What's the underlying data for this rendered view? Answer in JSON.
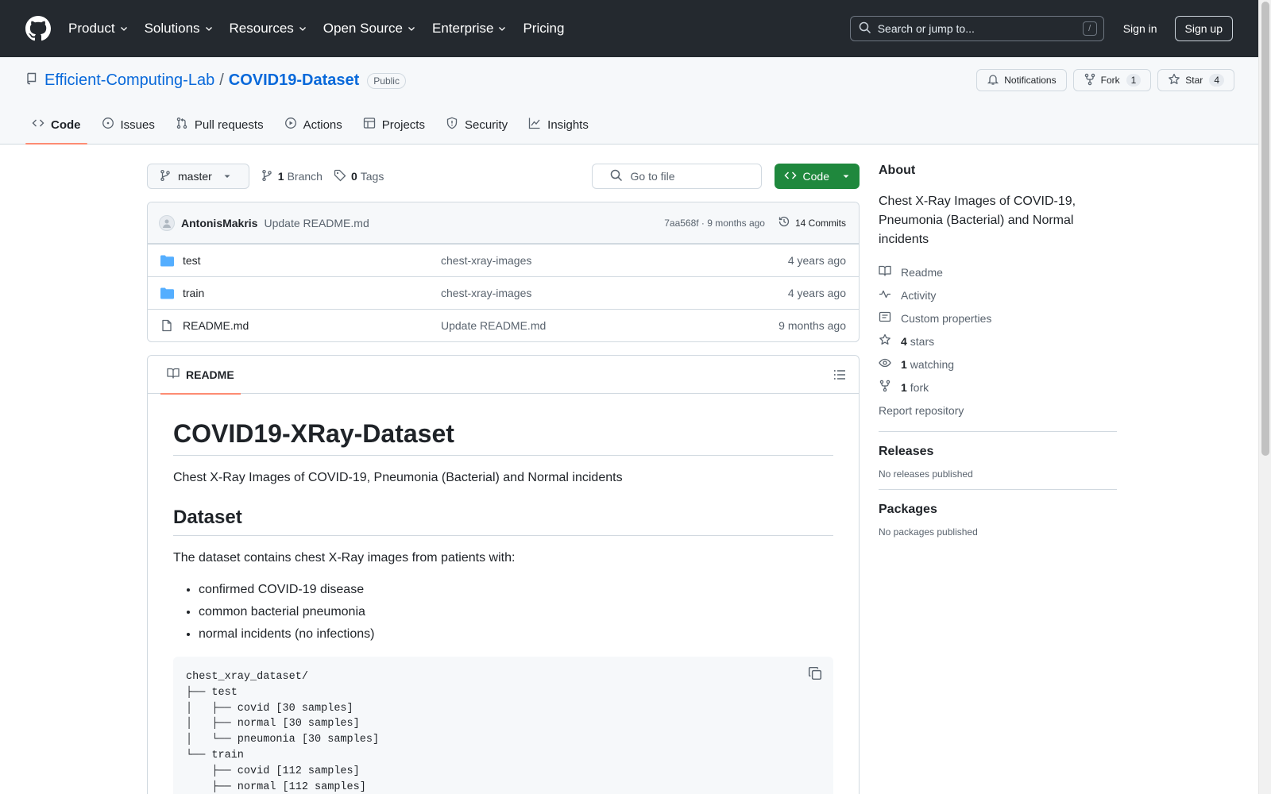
{
  "header": {
    "nav": [
      "Product",
      "Solutions",
      "Resources",
      "Open Source",
      "Enterprise",
      "Pricing"
    ],
    "search_placeholder": "Search or jump to...",
    "search_key": "/",
    "sign_in": "Sign in",
    "sign_up": "Sign up"
  },
  "repo": {
    "owner": "Efficient-Computing-Lab",
    "separator": "/",
    "name": "COVID19-Dataset",
    "visibility": "Public",
    "notifications_label": "Notifications",
    "fork_label": "Fork",
    "fork_count": "1",
    "star_label": "Star",
    "star_count": "4"
  },
  "tabs": [
    "Code",
    "Issues",
    "Pull requests",
    "Actions",
    "Projects",
    "Security",
    "Insights"
  ],
  "toolbar": {
    "branch": "master",
    "branch_count": "1",
    "branch_label": "Branch",
    "tag_count": "0",
    "tag_label": "Tags",
    "goto_placeholder": "Go to file",
    "code_button": "Code"
  },
  "commit": {
    "author": "AntonisMakris",
    "message": "Update README.md",
    "meta": "7aa568f · 9 months ago",
    "commits_label": "14 Commits"
  },
  "files": [
    {
      "name": "test",
      "type": "folder",
      "commit": "chest-xray-images",
      "date": "4 years ago"
    },
    {
      "name": "train",
      "type": "folder",
      "commit": "chest-xray-images",
      "date": "4 years ago"
    },
    {
      "name": "README.md",
      "type": "file",
      "commit": "Update README.md",
      "date": "9 months ago"
    }
  ],
  "readme": {
    "tab_label": "README",
    "title": "COVID19-XRay-Dataset",
    "intro": "Chest X-Ray Images of COVID-19, Pneumonia (Bacterial) and Normal incidents",
    "section": "Dataset",
    "section_text": "The dataset contains chest X-Ray images from patients with:",
    "bullets": [
      "confirmed COVID-19 disease",
      "common bacterial pneumonia",
      "normal incidents (no infections)"
    ],
    "code_lines": [
      "chest_xray_dataset/",
      "├── test",
      "│   ├── covid [30 samples]",
      "│   ├── normal [30 samples]",
      "│   └── pneumonia [30 samples]",
      "└── train",
      "    ├── covid [112 samples]",
      "    ├── normal [112 samples]"
    ]
  },
  "sidebar": {
    "about_title": "About",
    "about_desc": "Chest X-Ray Images of COVID-19, Pneumonia (Bacterial) and Normal incidents",
    "readme": "Readme",
    "activity": "Activity",
    "custom_properties": "Custom properties",
    "stars_count": "4",
    "stars_label": "stars",
    "watching_count": "1",
    "watching_label": "watching",
    "fork_count": "1",
    "fork_label": "fork",
    "report": "Report repository",
    "releases_title": "Releases",
    "releases_note": "No releases published",
    "packages_title": "Packages",
    "packages_note": "No packages published"
  },
  "colors": {
    "header_bg": "#24292f",
    "link": "#0969da",
    "primary_button": "#1f883d",
    "active_tab_underline": "#fd8c73",
    "folder_icon": "#54aeff"
  }
}
